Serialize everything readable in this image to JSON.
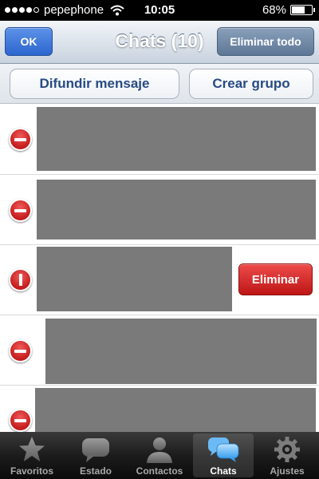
{
  "status_bar": {
    "carrier": "pepephone",
    "time": "10:05",
    "battery": "68%",
    "battery_level": 0.68,
    "signal_bars": 4,
    "signal_total": 5
  },
  "nav": {
    "ok_label": "OK",
    "title": "Chats (10)",
    "delete_all_label": "Eliminar todo"
  },
  "actions": {
    "broadcast_label": "Difundir mensaje",
    "create_group_label": "Crear grupo"
  },
  "chat_rows": {
    "delete_label": "Eliminar"
  },
  "tabs": [
    {
      "label": "Favoritos",
      "icon": "star-icon",
      "active": false
    },
    {
      "label": "Estado",
      "icon": "speech-bubble-icon",
      "active": false
    },
    {
      "label": "Contactos",
      "icon": "person-icon",
      "active": false
    },
    {
      "label": "Chats",
      "icon": "chat-bubbles-icon",
      "active": true
    },
    {
      "label": "Ajustes",
      "icon": "gear-icon",
      "active": false
    }
  ],
  "colors": {
    "ok_button": "#2c66cf",
    "delete_red": "#c41c1c",
    "action_text": "#274b83",
    "redacted": "#7a7a7a"
  }
}
